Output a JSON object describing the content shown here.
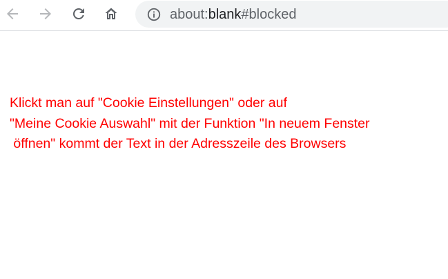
{
  "toolbar": {
    "back_icon": "arrow-back-icon",
    "forward_icon": "arrow-forward-icon",
    "reload_icon": "reload-icon",
    "home_icon": "home-icon",
    "colors": {
      "icon": "#5f6368",
      "icon_disabled": "#b5b7ba",
      "omnibox_bg": "#f1f3f4"
    }
  },
  "address_bar": {
    "info_icon": "info-icon",
    "scheme": "about:",
    "host": "blank",
    "rest": "#blocked"
  },
  "page": {
    "text_color": "#ff0000",
    "lines": [
      "Klickt man auf \"Cookie Einstellungen\" oder auf",
      "\"Meine Cookie Auswahl\" mit der Funktion \"In neuem Fenster",
      " öffnen\" kommt der Text in der Adresszeile des Browsers"
    ]
  }
}
